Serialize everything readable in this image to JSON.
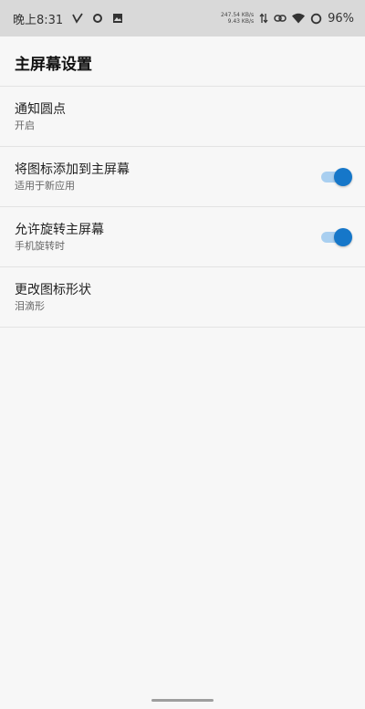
{
  "status_bar": {
    "time": "晚上8:31",
    "net_up": "247.54 KB/s",
    "net_down": "9.43 KB/s",
    "battery": "96%",
    "icons": [
      "v-icon",
      "circle-icon",
      "image-icon",
      "data-arrows-icon",
      "link-icon",
      "wifi-icon",
      "battery-ring-icon"
    ]
  },
  "header": {
    "title": "主屏幕设置"
  },
  "settings": [
    {
      "title": "通知圆点",
      "summary": "开启",
      "has_toggle": false
    },
    {
      "title": "将图标添加到主屏幕",
      "summary": "适用于新应用",
      "has_toggle": true,
      "toggle_on": true
    },
    {
      "title": "允许旋转主屏幕",
      "summary": "手机旋转时",
      "has_toggle": true,
      "toggle_on": true
    },
    {
      "title": "更改图标形状",
      "summary": "泪滴形",
      "has_toggle": false
    }
  ],
  "colors": {
    "accent": "#1677c9",
    "toggle_track": "#a9cff0",
    "status_bar_bg": "#d9d9d9",
    "page_bg": "#f7f7f7"
  }
}
